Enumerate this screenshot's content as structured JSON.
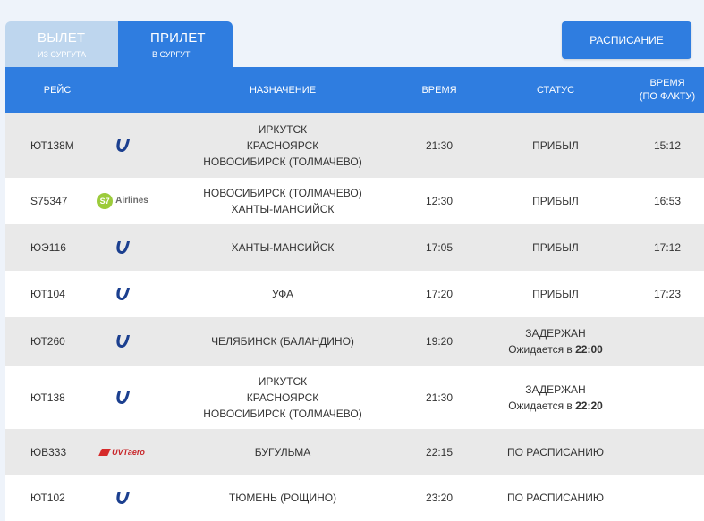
{
  "tabs": {
    "departure": {
      "title": "ВЫЛЕТ",
      "subtitle": "ИЗ СУРГУТА"
    },
    "arrival": {
      "title": "ПРИЛЕТ",
      "subtitle": "В СУРГУТ"
    }
  },
  "schedule_button": "РАСПИСАНИЕ",
  "columns": {
    "flight": "РЕЙС",
    "destination": "НАЗНАЧЕНИЕ",
    "time": "ВРЕМЯ",
    "status": "СТАТУС",
    "actual_line1": "ВРЕМЯ",
    "actual_line2": "(ПО ФАКТУ)"
  },
  "colors": {
    "accent": "#2f7de0",
    "tab_inactive": "#bed6ee",
    "row_alt": "#e9e9e9"
  },
  "rows": [
    {
      "flight": "ЮТ138М",
      "airline_logo": "utair-logo",
      "dest": [
        "ИРКУТСК",
        "КРАСНОЯРСК",
        "НОВОСИБИРСК (ТОЛМАЧЕВО)"
      ],
      "time": "21:30",
      "status": "ПРИБЫЛ",
      "status_sub": "",
      "status_time": "",
      "actual": "15:12"
    },
    {
      "flight": "S75347",
      "airline_logo": "s7-airlines-logo",
      "logo_text": "S7",
      "logo_word": "Airlines",
      "dest": [
        "НОВОСИБИРСК (ТОЛМАЧЕВО)",
        "ХАНТЫ-МАНСИЙСК"
      ],
      "time": "12:30",
      "status": "ПРИБЫЛ",
      "status_sub": "",
      "status_time": "",
      "actual": "16:53"
    },
    {
      "flight": "ЮЭ116",
      "airline_logo": "utair-logo",
      "dest": [
        "ХАНТЫ-МАНСИЙСК"
      ],
      "time": "17:05",
      "status": "ПРИБЫЛ",
      "status_sub": "",
      "status_time": "",
      "actual": "17:12"
    },
    {
      "flight": "ЮТ104",
      "airline_logo": "utair-logo",
      "dest": [
        "УФА"
      ],
      "time": "17:20",
      "status": "ПРИБЫЛ",
      "status_sub": "",
      "status_time": "",
      "actual": "17:23"
    },
    {
      "flight": "ЮТ260",
      "airline_logo": "utair-logo",
      "dest": [
        "ЧЕЛЯБИНСК (БАЛАНДИНО)"
      ],
      "time": "19:20",
      "status": "ЗАДЕРЖАН",
      "status_sub": "Ожидается в",
      "status_time": "22:00",
      "actual": ""
    },
    {
      "flight": "ЮТ138",
      "airline_logo": "utair-logo",
      "dest": [
        "ИРКУТСК",
        "КРАСНОЯРСК",
        "НОВОСИБИРСК (ТОЛМАЧЕВО)"
      ],
      "time": "21:30",
      "status": "ЗАДЕРЖАН",
      "status_sub": "Ожидается в",
      "status_time": "22:20",
      "actual": ""
    },
    {
      "flight": "ЮВ333",
      "airline_logo": "uvt-aero-logo",
      "logo_text": "UVTaero",
      "dest": [
        "БУГУЛЬМА"
      ],
      "time": "22:15",
      "status": "ПО РАСПИСАНИЮ",
      "status_sub": "",
      "status_time": "",
      "actual": ""
    },
    {
      "flight": "ЮТ102",
      "airline_logo": "utair-logo",
      "dest": [
        "ТЮМЕНЬ (РОЩИНО)"
      ],
      "time": "23:20",
      "status": "ПО РАСПИСАНИЮ",
      "status_sub": "",
      "status_time": "",
      "actual": ""
    }
  ]
}
